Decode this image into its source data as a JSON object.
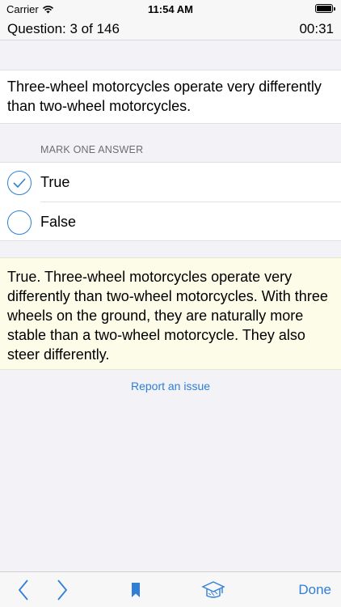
{
  "status_bar": {
    "carrier": "Carrier",
    "time": "11:54 AM"
  },
  "header": {
    "question_counter": "Question: 3 of 146",
    "timer": "00:31"
  },
  "question": {
    "text": "Three-wheel motorcycles operate very differently than two-wheel motorcycles."
  },
  "answers": {
    "section_title": "MARK ONE ANSWER",
    "options": [
      {
        "label": "True",
        "selected": true
      },
      {
        "label": "False",
        "selected": false
      }
    ]
  },
  "explanation": {
    "text": "True. Three-wheel motorcycles operate very differently than two-wheel motorcycles. With three wheels on the ground, they are naturally more stable than a two-wheel motorcycle. They also steer differently."
  },
  "report_link": "Report an issue",
  "toolbar": {
    "done_label": "Done",
    "icons": [
      "chevron-left-icon",
      "chevron-right-icon",
      "bookmark-icon",
      "graduation-cap-icon"
    ]
  },
  "colors": {
    "accent": "#2f7fd6",
    "explanation_bg": "#fcfce8",
    "page_bg": "#f2f2f7"
  }
}
